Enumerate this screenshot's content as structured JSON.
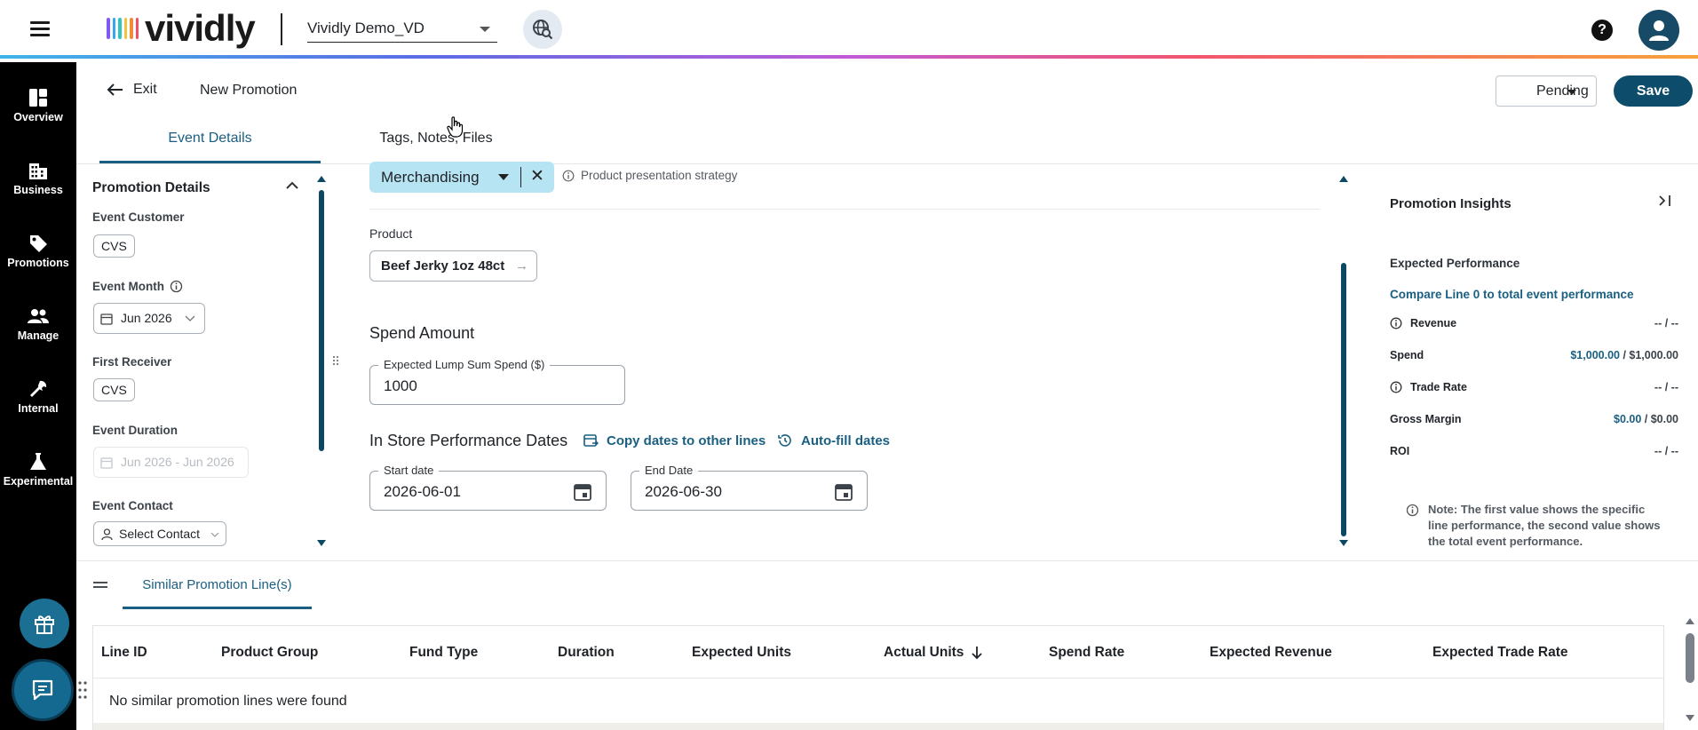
{
  "header": {
    "logo_text": "vividly",
    "logo_colors": [
      "#7a5cf0",
      "#3aa5ea",
      "#2ec4c4",
      "#f2c23a",
      "#f28a3a",
      "#ef4f6a"
    ],
    "account_name": "Vividly Demo_VD",
    "icons": {
      "menu": "hamburger-icon",
      "globe": "globe-search-icon",
      "help": "help-icon",
      "user": "user-icon"
    }
  },
  "leftnav": {
    "items": [
      {
        "label": "Overview",
        "icon": "overview-icon"
      },
      {
        "label": "Business",
        "icon": "building-icon"
      },
      {
        "label": "Promotions",
        "icon": "tag-icon"
      },
      {
        "label": "Manage",
        "icon": "people-icon"
      },
      {
        "label": "Internal",
        "icon": "wrench-icon"
      },
      {
        "label": "Experimental",
        "icon": "flask-icon"
      }
    ],
    "fab_gift_icon": "gift-icon",
    "fab_chat_icon": "chat-icon"
  },
  "subheader": {
    "exit_label": "Exit",
    "title": "New Promotion",
    "status": "Pending",
    "save_label": "Save"
  },
  "tabs": [
    {
      "label": "Event Details",
      "active": true
    },
    {
      "label": "Tags, Notes, Files",
      "active": false
    }
  ],
  "details": {
    "title": "Promotion Details",
    "event_customer_label": "Event Customer",
    "event_customer": "CVS",
    "event_month_label": "Event Month",
    "event_month": "Jun 2026",
    "first_receiver_label": "First Receiver",
    "first_receiver": "CVS",
    "event_duration_label": "Event Duration",
    "event_duration": "Jun 2026 - Jun 2026",
    "event_contact_label": "Event Contact",
    "event_contact": "Select Contact"
  },
  "form": {
    "fund_type": "Merchandising",
    "fund_type_hint": "Product presentation strategy",
    "product_label": "Product",
    "product": "Beef Jerky 1oz 48ct",
    "spend_section": "Spend Amount",
    "lump_sum_label": "Expected Lump Sum Spend ($)",
    "lump_sum_value": "1000",
    "dates_section": "In Store Performance Dates",
    "copy_dates_label": "Copy dates to other lines",
    "autofill_label": "Auto-fill dates",
    "start_label": "Start date",
    "start_value": "2026-06-01",
    "end_label": "End Date",
    "end_value": "2026-06-30"
  },
  "insights": {
    "title": "Promotion Insights",
    "subtitle": "Expected Performance",
    "compare": "Compare Line 0 to total event performance",
    "metrics": [
      {
        "label": "Revenue",
        "info": true,
        "line": "--",
        "total": "--"
      },
      {
        "label": "Spend",
        "info": false,
        "line": "$1,000.00",
        "total": "$1,000.00"
      },
      {
        "label": "Trade Rate",
        "info": true,
        "line": "--",
        "total": "--"
      },
      {
        "label": "Gross Margin",
        "info": false,
        "line": "$0.00",
        "total": "$0.00"
      },
      {
        "label": "ROI",
        "info": false,
        "line": "--",
        "total": "--"
      }
    ],
    "separator": " / ",
    "note": "Note: The first value shows the specific line performance, the second value shows the total event performance."
  },
  "similar": {
    "tab_label": "Similar Promotion Line(s)",
    "columns": [
      "Line ID",
      "Product Group",
      "Fund Type",
      "Duration",
      "Expected Units",
      "Actual Units",
      "Spend Rate",
      "Expected Revenue",
      "Expected Trade Rate"
    ],
    "sorted_column": "Actual Units",
    "sort_direction": "descending",
    "empty_message": "No similar promotion lines were found"
  },
  "colors": {
    "primary": "#0e4c6b",
    "link": "#1a5f82",
    "chip_highlight": "#b6e4f3",
    "nav_bg": "#000000"
  }
}
